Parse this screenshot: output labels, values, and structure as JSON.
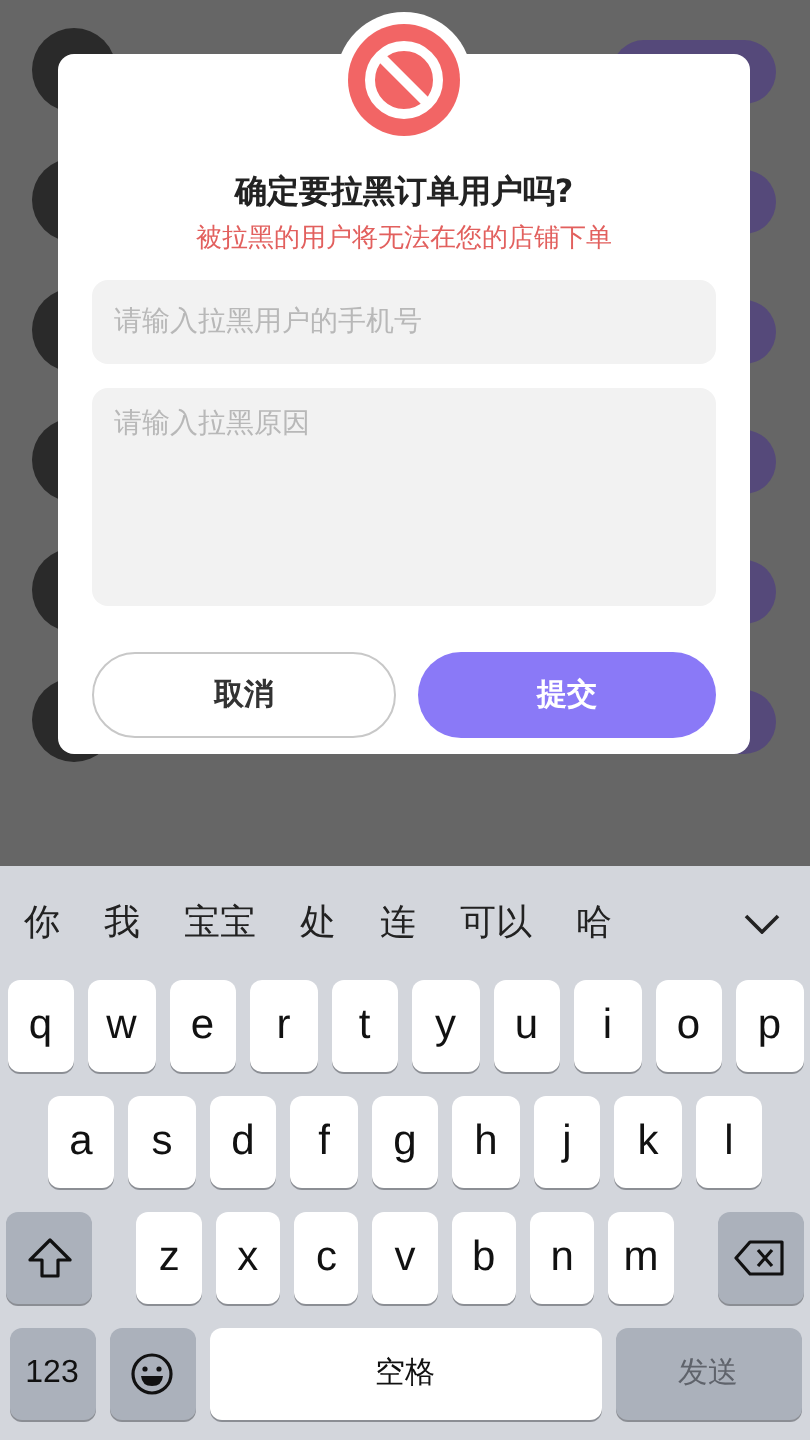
{
  "dialog": {
    "title": "确定要拉黑订单用户吗?",
    "subtitle": "被拉黑的用户将无法在您的店铺下单",
    "phone_field": {
      "placeholder": "请输入拉黑用户的手机号"
    },
    "reason_field": {
      "placeholder": "请输入拉黑原因"
    },
    "buttons": [
      {
        "label": "取消",
        "kind": "secondary"
      },
      {
        "label": "提交",
        "kind": "primary"
      }
    ]
  },
  "keyboard": {
    "suggestions": [
      "你",
      "我",
      "宝宝",
      "处",
      "连",
      "可以",
      "哈"
    ],
    "top_row": [
      {
        "kind": "letter",
        "label": "q"
      },
      {
        "kind": "letter",
        "label": "w"
      },
      {
        "kind": "letter",
        "label": "e"
      },
      {
        "kind": "letter",
        "label": "r"
      },
      {
        "kind": "letter",
        "label": "t"
      },
      {
        "kind": "letter",
        "label": "y"
      },
      {
        "kind": "letter",
        "label": "u"
      },
      {
        "kind": "letter",
        "label": "i"
      },
      {
        "kind": "letter",
        "label": "o"
      },
      {
        "kind": "letter",
        "label": "p"
      }
    ],
    "middle_row": [
      {
        "kind": "letter",
        "label": "a"
      },
      {
        "kind": "letter",
        "label": "s"
      },
      {
        "kind": "letter",
        "label": "d"
      },
      {
        "kind": "letter",
        "label": "f"
      },
      {
        "kind": "letter",
        "label": "g"
      },
      {
        "kind": "letter",
        "label": "h"
      },
      {
        "kind": "letter",
        "label": "j"
      },
      {
        "kind": "letter",
        "label": "k"
      },
      {
        "kind": "letter",
        "label": "l"
      }
    ],
    "lower_row": [
      {
        "kind": "shift"
      },
      {
        "kind": "letter",
        "label": "z"
      },
      {
        "kind": "letter",
        "label": "x"
      },
      {
        "kind": "letter",
        "label": "c"
      },
      {
        "kind": "letter",
        "label": "v"
      },
      {
        "kind": "letter",
        "label": "b"
      },
      {
        "kind": "letter",
        "label": "n"
      },
      {
        "kind": "letter",
        "label": "m"
      },
      {
        "kind": "delete"
      }
    ],
    "function_row": [
      {
        "kind": "number",
        "label": "123"
      },
      {
        "kind": "emoji"
      },
      {
        "kind": "space",
        "label": "空格"
      },
      {
        "kind": "send",
        "label": "发送",
        "disabled": true
      }
    ]
  }
}
